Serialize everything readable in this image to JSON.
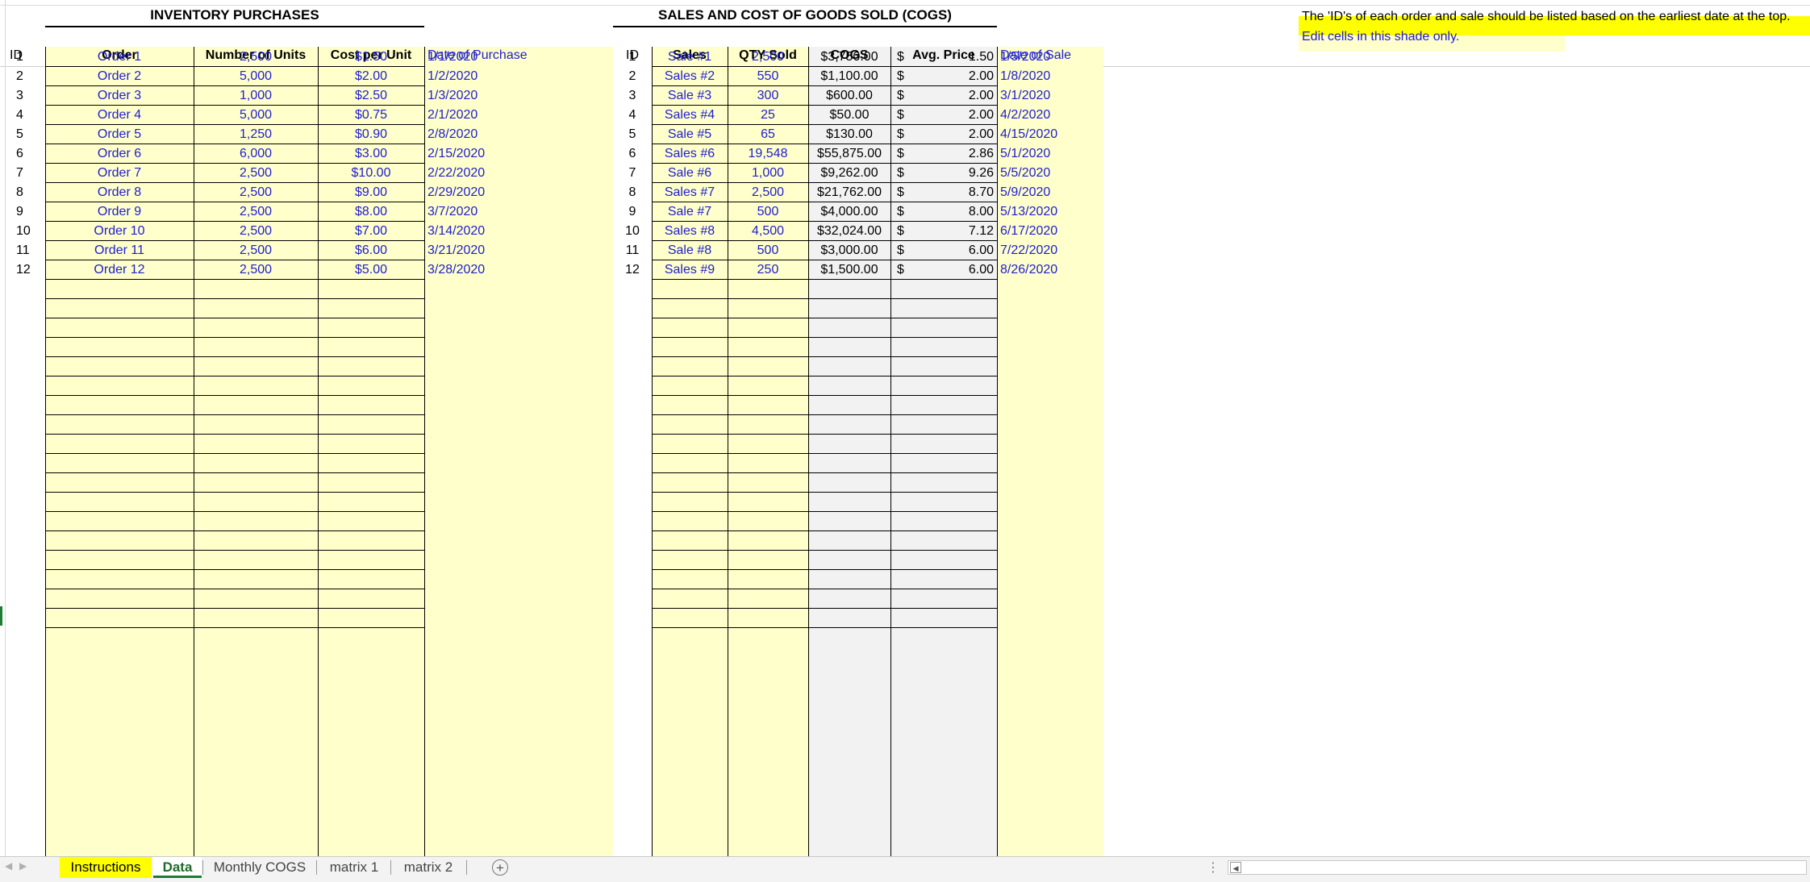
{
  "inventory": {
    "title": "INVENTORY PURCHASES",
    "headers": [
      "ID",
      "Order",
      "Number of Units",
      "Cost per Unit",
      "Date of Purchase"
    ],
    "rows": [
      [
        "1",
        "Order 1",
        "2,500",
        "$1.50",
        "1/1/2020"
      ],
      [
        "2",
        "Order 2",
        "5,000",
        "$2.00",
        "1/2/2020"
      ],
      [
        "3",
        "Order 3",
        "1,000",
        "$2.50",
        "1/3/2020"
      ],
      [
        "4",
        "Order 4",
        "5,000",
        "$0.75",
        "2/1/2020"
      ],
      [
        "5",
        "Order 5",
        "1,250",
        "$0.90",
        "2/8/2020"
      ],
      [
        "6",
        "Order 6",
        "6,000",
        "$3.00",
        "2/15/2020"
      ],
      [
        "7",
        "Order 7",
        "2,500",
        "$10.00",
        "2/22/2020"
      ],
      [
        "8",
        "Order 8",
        "2,500",
        "$9.00",
        "2/29/2020"
      ],
      [
        "9",
        "Order 9",
        "2,500",
        "$8.00",
        "3/7/2020"
      ],
      [
        "10",
        "Order 10",
        "2,500",
        "$7.00",
        "3/14/2020"
      ],
      [
        "11",
        "Order 11",
        "2,500",
        "$6.00",
        "3/21/2020"
      ],
      [
        "12",
        "Order 12",
        "2,500",
        "$5.00",
        "3/28/2020"
      ]
    ]
  },
  "sales": {
    "title": "SALES AND COST OF GOODS SOLD (COGS)",
    "headers": [
      "ID",
      "Sales",
      "QTY Sold",
      "COGS",
      "Avg. Price",
      "Date of Sale"
    ],
    "rows": [
      [
        "1",
        "Sale #1",
        "2,500",
        "$3,750.00",
        "$",
        "1.50",
        "1/5/2020"
      ],
      [
        "2",
        "Sales #2",
        "550",
        "$1,100.00",
        "$",
        "2.00",
        "1/8/2020"
      ],
      [
        "3",
        "Sale #3",
        "300",
        "$600.00",
        "$",
        "2.00",
        "3/1/2020"
      ],
      [
        "4",
        "Sales #4",
        "25",
        "$50.00",
        "$",
        "2.00",
        "4/2/2020"
      ],
      [
        "5",
        "Sale #5",
        "65",
        "$130.00",
        "$",
        "2.00",
        "4/15/2020"
      ],
      [
        "6",
        "Sales #6",
        "19,548",
        "$55,875.00",
        "$",
        "2.86",
        "5/1/2020"
      ],
      [
        "7",
        "Sale #6",
        "1,000",
        "$9,262.00",
        "$",
        "9.26",
        "5/5/2020"
      ],
      [
        "8",
        "Sales #7",
        "2,500",
        "$21,762.00",
        "$",
        "8.70",
        "5/9/2020"
      ],
      [
        "9",
        "Sale #7",
        "500",
        "$4,000.00",
        "$",
        "8.00",
        "5/13/2020"
      ],
      [
        "10",
        "Sales #8",
        "4,500",
        "$32,024.00",
        "$",
        "7.12",
        "6/17/2020"
      ],
      [
        "11",
        "Sale #8",
        "500",
        "$3,000.00",
        "$",
        "6.00",
        "7/22/2020"
      ],
      [
        "12",
        "Sales #9",
        "250",
        "$1,500.00",
        "$",
        "6.00",
        "8/26/2020"
      ]
    ]
  },
  "notes": {
    "id_note": "The 'ID's of each order and sale should be listed based on the earliest date at the top.",
    "edit_note": "Edit cells in this shade only."
  },
  "tabs": [
    {
      "label": "Instructions",
      "state": "highlight"
    },
    {
      "label": "Data",
      "state": "active"
    },
    {
      "label": "Monthly COGS",
      "state": "normal"
    },
    {
      "label": "matrix 1",
      "state": "normal"
    },
    {
      "label": "matrix 2",
      "state": "normal"
    }
  ],
  "colors": {
    "input_yellow": "#ffffcc",
    "highlight_yellow": "#ffff00",
    "formula_gray": "#f2f2f2",
    "input_text_blue": "#2020d0",
    "active_tab_green": "#1f7a35"
  },
  "icons": {
    "add_sheet": "plus-circle-icon",
    "prev_sheet": "triangle-left-icon",
    "next_sheet": "triangle-right-icon",
    "more": "vertical-dots-icon"
  }
}
